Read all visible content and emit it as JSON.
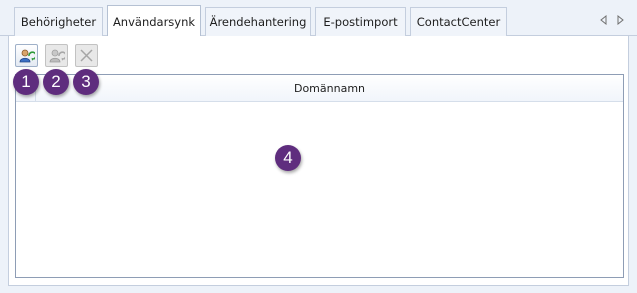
{
  "tabs": [
    {
      "label": "Behörigheter",
      "active": false
    },
    {
      "label": "Användarsynk",
      "active": true
    },
    {
      "label": "Ärendehantering",
      "active": false
    },
    {
      "label": "E-postimport",
      "active": false
    },
    {
      "label": "ContactCenter",
      "active": false
    }
  ],
  "tab_nav": {
    "prev_icon": "triangle-left-icon",
    "next_icon": "triangle-right-icon"
  },
  "toolbar": {
    "buttons": [
      {
        "icon": "sync-user-icon",
        "enabled": true
      },
      {
        "icon": "sync-user-icon",
        "enabled": false
      },
      {
        "icon": "close-x-icon",
        "enabled": false
      }
    ]
  },
  "grid": {
    "columns": [
      "Domännamn"
    ],
    "rows": []
  },
  "callouts": [
    "1",
    "2",
    "3",
    "4"
  ],
  "colors": {
    "callout": "#5f2d7e",
    "background": "#edf2f9",
    "border": "#c4cede"
  }
}
